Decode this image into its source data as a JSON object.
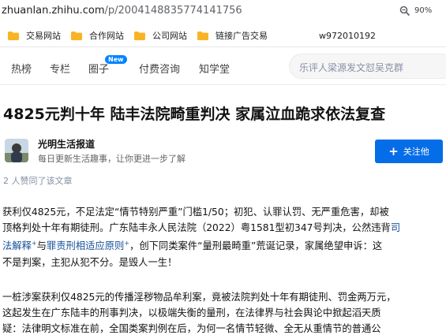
{
  "browser": {
    "url_domain": "zhuanlan.zhihu.com",
    "url_path": "/p/2004148835774141756",
    "zoom": "90%"
  },
  "bookmarks": {
    "items": [
      {
        "label": "交易网站"
      },
      {
        "label": "合作网站"
      },
      {
        "label": "公司网站"
      },
      {
        "label": "链接广告交易"
      }
    ],
    "text_item": "w972010192",
    "folder_color": "#f9b425"
  },
  "header": {
    "nav": [
      {
        "label": "热榜"
      },
      {
        "label": "专栏"
      },
      {
        "label": "圈子"
      },
      {
        "label": "付费咨询"
      },
      {
        "label": "知学堂"
      }
    ],
    "new_badge": "New",
    "search_placeholder": "乐评人梁源发文怼吴克群"
  },
  "article": {
    "title": "4825元判十年 陆丰法院畸重判决 家属泣血跪求依法复查",
    "author_name": "光明生活报道",
    "author_desc": "每日更新生活趣事，让你更进一步了解",
    "follow_label": "关注他",
    "likes_text": "2 人赞同了该文章",
    "para1": {
      "l1": "获利仅4825元，不足法定“情节特别严重”门槛1/50；初犯、认罪认罚、无严重危害，却被",
      "l2": "顶格判处十年有期徒刑。广东陆丰永人民法院（2022）粤1581型初347号判决，公然违背",
      "l2_link": "司",
      "l3_link1": "法解释",
      "l3_mid": "与",
      "l3_link2": "罪责刑相适应原则",
      "l3_rest": "，创下同类案件“量刑最畸重”荒诞记录，家属绝望申诉：这",
      "l4": "不是判案，主犯从犯不分。是毁人一生！"
    },
    "para2": {
      "l1": "一桩涉案获利仅4825元的传播淫秽物品牟利案，竟被法院判处十年有期徒刑、罚金两万元，",
      "l2": "这起发生在广东陆丰的刑事判决，以极端失衡的量刑，在法律界与社会舆论中掀起滔天质",
      "l3": "疑：法律明文标准在前，全国类案判例在后，为何一名情节轻微、全无从重情节的普通公"
    },
    "accent_color": "#056de8",
    "link_color": "#175199"
  }
}
